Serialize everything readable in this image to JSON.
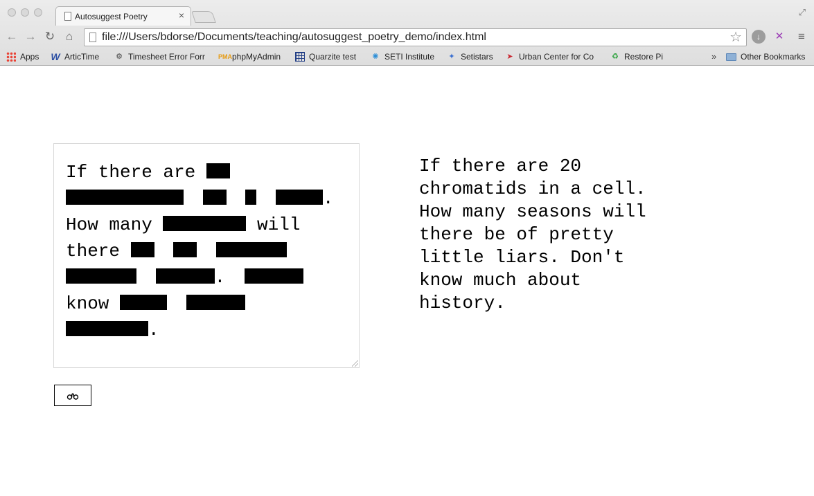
{
  "browser": {
    "tab_title": "Autosuggest Poetry",
    "tab_close": "×",
    "url": "file:///Users/bdorse/Documents/teaching/autosuggest_poetry_demo/index.html",
    "bookmarks": [
      {
        "label": "Apps",
        "icon": "apps-grid-icon"
      },
      {
        "label": "ArticTime",
        "icon": "w-logo-icon"
      },
      {
        "label": "Timesheet Error Forr",
        "icon": "gear-icon"
      },
      {
        "label": "phpMyAdmin",
        "icon": "phpmyadmin-icon"
      },
      {
        "label": "Quarzite test",
        "icon": "grid-icon"
      },
      {
        "label": "SETI Institute",
        "icon": "seti-icon"
      },
      {
        "label": "Setistars",
        "icon": "star-person-icon"
      },
      {
        "label": "Urban Center for Co",
        "icon": "flag-icon"
      },
      {
        "label": "Restore Pi",
        "icon": "recycle-icon"
      }
    ],
    "overflow_chevron": "»",
    "other_bookmarks": "Other Bookmarks"
  },
  "poem": {
    "masked_lines": [
      {
        "words": [
          "If",
          "there",
          "are"
        ],
        "mask_after": 1
      },
      {
        "mask_count": 4,
        "trailing": "."
      },
      {
        "words": [
          "How",
          "many"
        ],
        "mask_after": 1,
        "after_word": "will"
      },
      {
        "words": [
          "there"
        ],
        "mask_after": 3
      },
      {
        "mask_count": 2,
        "trailing": ".",
        "mask_after_period": 1
      },
      {
        "words": [
          "know"
        ],
        "mask_after": 2
      },
      {
        "mask_count": 1,
        "trailing": "."
      }
    ],
    "masked_prefix_words": {
      "line1": "If there are",
      "line3a": "How many",
      "line3b": "will",
      "line4": "there",
      "line6": "know"
    },
    "revealed_text": "If there are 20\nchromatids in a cell.\nHow many seasons will\nthere be of pretty\nlittle liars. Don't\nknow much about\nhistory."
  },
  "controls": {
    "reveal_icon": "glasses-icon"
  }
}
